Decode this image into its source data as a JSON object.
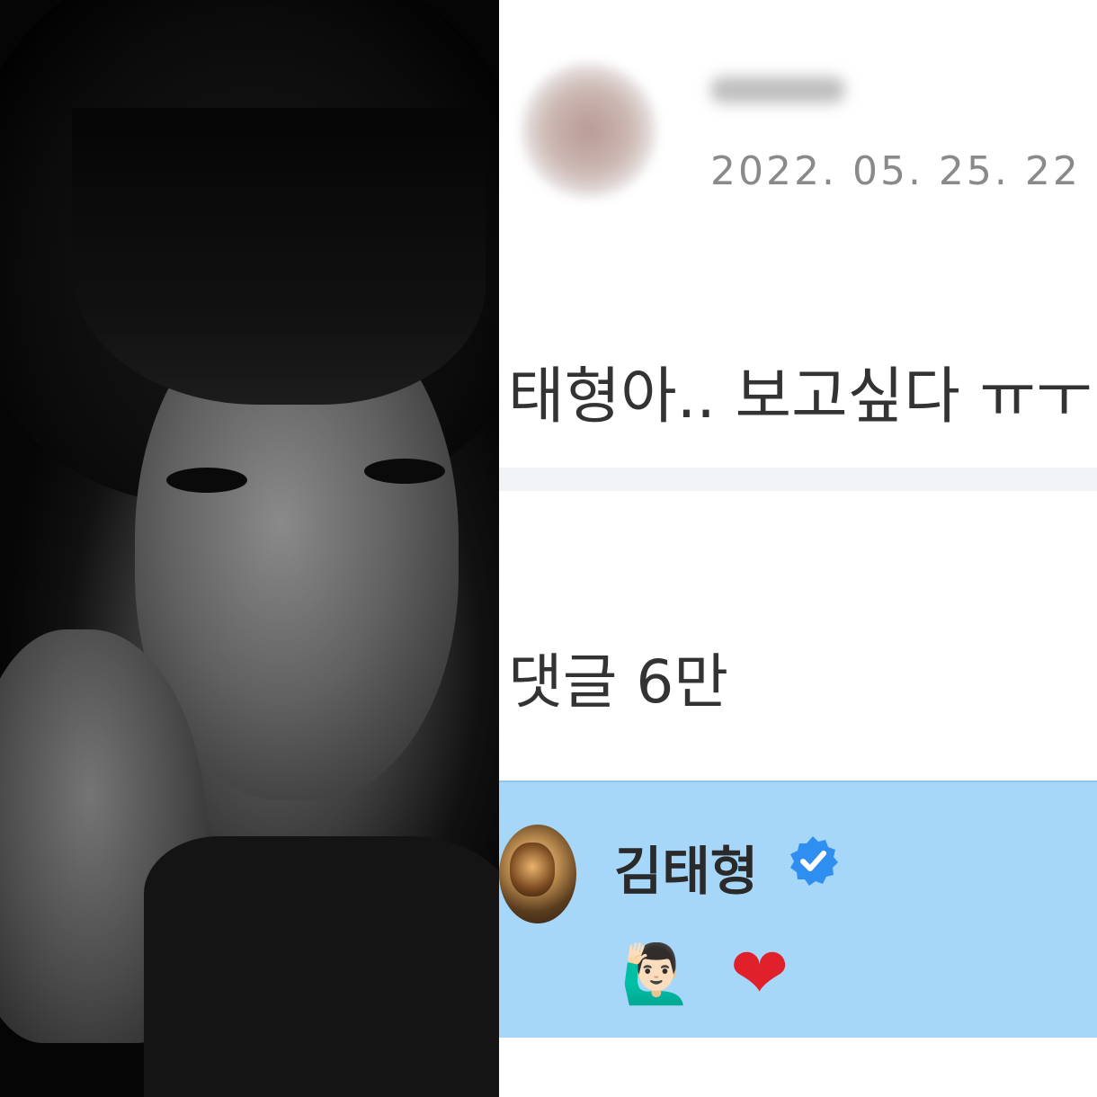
{
  "post": {
    "date": "2022. 05. 25. 22",
    "text": "태형아.. 보고싶다 ㅠㅜ"
  },
  "comments_label": "댓글 6만",
  "reply": {
    "author": "김태형",
    "verified_icon": "verified-badge-icon",
    "emoji_1": "🙋🏻‍♂️",
    "emoji_2": "❤"
  },
  "colors": {
    "highlight": "#a6d6f8",
    "verified": "#2f8ff0",
    "heart": "#e0202a"
  }
}
